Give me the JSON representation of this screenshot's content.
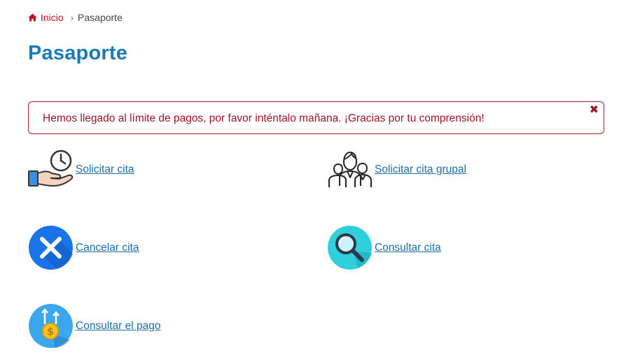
{
  "breadcrumb": {
    "home_label": "Inicio",
    "home_icon": "home-icon",
    "separator_icon": "chevron-right-icon",
    "current": "Pasaporte"
  },
  "page_title": "Pasaporte",
  "alert": {
    "message": "Hemos llegado al límite de pagos, por favor inténtalo mañana. ¡Gracias por tu comprensión!",
    "close_icon": "close-icon"
  },
  "options": [
    {
      "label": "Solicitar cita",
      "icon": "clock-hand-icon"
    },
    {
      "label": "Solicitar cita grupal",
      "icon": "group-people-icon"
    },
    {
      "label": "Cancelar cita",
      "icon": "cancel-x-icon"
    },
    {
      "label": "Consultar cita",
      "icon": "magnifier-icon"
    },
    {
      "label": "Consultar el pago",
      "icon": "payment-coin-icon"
    }
  ],
  "colors": {
    "title": "#1a7ab9",
    "link": "#1a6ea8",
    "alert": "#9b1424",
    "breadcrumb_home": "#c8102e"
  }
}
